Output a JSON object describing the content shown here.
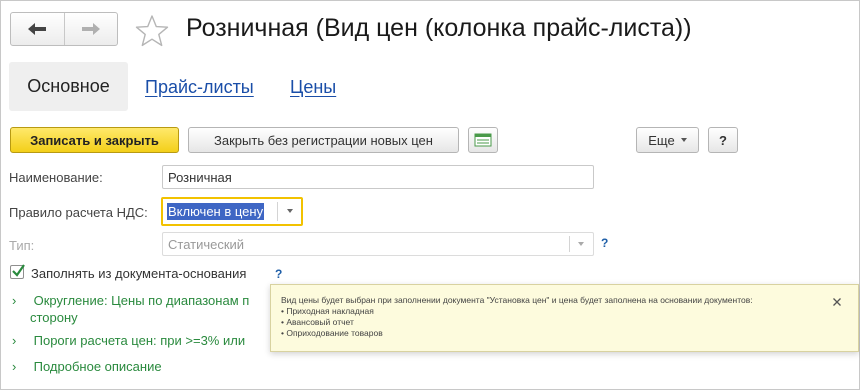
{
  "header": {
    "title": "Розничная (Вид цен (колонка прайс-листа))",
    "back_icon": "arrow-left-icon",
    "forward_icon": "arrow-right-icon",
    "favorite_icon": "star-icon"
  },
  "tabs": [
    {
      "label": "Основное",
      "active": true
    },
    {
      "label": "Прайс-листы",
      "active": false
    },
    {
      "label": "Цены",
      "active": false
    }
  ],
  "toolbar": {
    "save_close_label": "Записать и закрыть",
    "close_no_reg_label": "Закрыть без регистрации новых цен",
    "more_label": "Еще",
    "help_label": "?"
  },
  "form": {
    "name_label": "Наименование:",
    "name_value": "Розничная",
    "vat_label": "Правило расчета НДС:",
    "vat_value": "Включен в цену",
    "type_label": "Тип:",
    "type_value": "Статический",
    "type_help": "?",
    "fill_label": "Заполнять из документа-основания",
    "fill_checked": true,
    "fill_help": "?"
  },
  "groups": [
    {
      "line1": "Округление: Цены по диапазонам п",
      "line2": "сторону"
    },
    {
      "line1": "Пороги расчета цен: при >=3%  или"
    },
    {
      "line1": "Подробное описание"
    }
  ],
  "tooltip": {
    "text": "Вид цены будет выбран при заполнении документа \"Установка цен\" и цена будет заполнена на основании документов:",
    "items": [
      "• Приходная накладная",
      "• Авансовый отчет",
      "• Оприходование товаров"
    ]
  },
  "colors": {
    "accent_yellow": "#f3cf19",
    "link_blue": "#1a4ea8",
    "group_green": "#2a8a3e",
    "focus_border": "#f2c200",
    "selection": "#3e66c4"
  }
}
